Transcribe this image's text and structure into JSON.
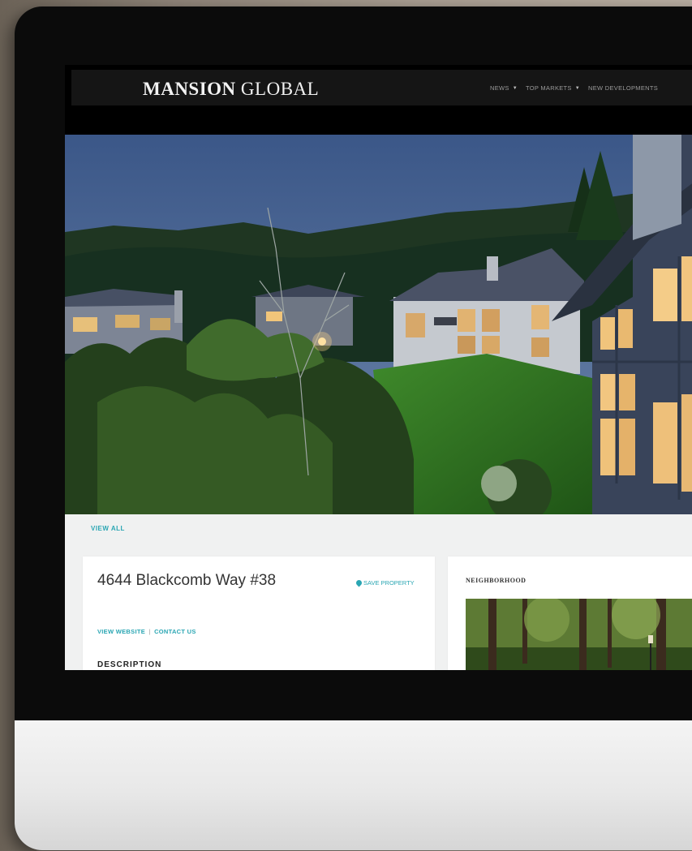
{
  "site": {
    "logo_bold": "MANSION",
    "logo_light": "GLOBAL"
  },
  "nav": {
    "items": [
      {
        "label": "NEWS",
        "caret": "▼"
      },
      {
        "label": "TOP MARKETS",
        "caret": "▼"
      },
      {
        "label": "NEW DEVELOPMENTS",
        "caret": ""
      }
    ]
  },
  "listing": {
    "view_all": "VIEW ALL",
    "address": "4644 Blackcomb Way #38",
    "save_label": "SAVE PROPERTY",
    "website_link": "VIEW WEBSITE",
    "separator": "|",
    "contact_link": "CONTACT US",
    "description_heading": "DESCRIPTION"
  },
  "neighborhood": {
    "title": "NEIGHBORHOOD"
  },
  "colors": {
    "accent": "#2aa6b3",
    "nav_bg": "#151515",
    "page_bg": "#f0f1f1"
  }
}
